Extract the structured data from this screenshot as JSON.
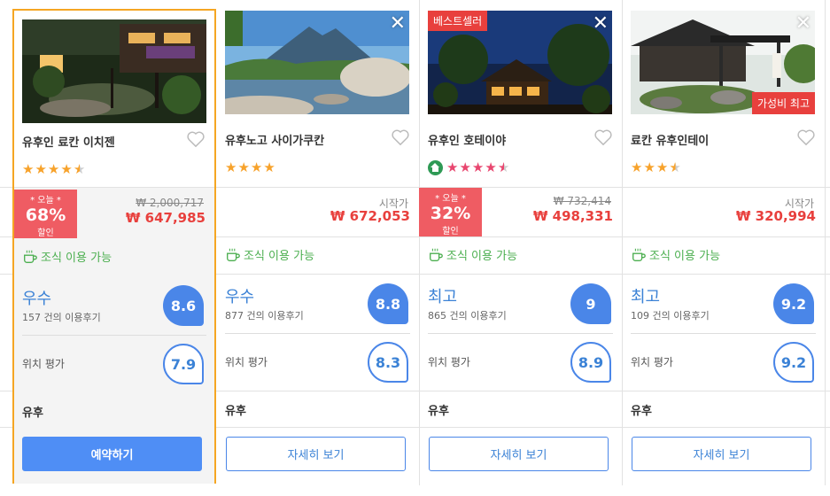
{
  "hotels": [
    {
      "name": "유후인 료칸 이치젠",
      "stars": {
        "full": 4,
        "half": true,
        "style": "orange"
      },
      "discount": {
        "today": "* 오늘 *",
        "percent": "68%",
        "label": "할인"
      },
      "original_price": "₩ 2,000,717",
      "price": "₩ 647,985",
      "breakfast": "조식 이용 가능",
      "rating_word": "우수",
      "reviews": "157 건의 이용후기",
      "score": "8.6",
      "location_label": "위치 평가",
      "location_score": "7.9",
      "area": "유후",
      "button": "예약하기",
      "selected": true
    },
    {
      "name": "유후노고 사이가쿠칸",
      "stars": {
        "full": 4,
        "half": false,
        "style": "orange"
      },
      "from_label": "시작가",
      "price": "₩ 672,053",
      "breakfast": "조식 이용 가능",
      "rating_word": "우수",
      "reviews": "877 건의 이용후기",
      "score": "8.8",
      "location_label": "위치 평가",
      "location_score": "8.3",
      "area": "유후",
      "button": "자세히 보기",
      "selected": false
    },
    {
      "name": "유후인 호테이야",
      "badge": "베스트셀러",
      "stars": {
        "full": 4,
        "half": true,
        "style": "pink"
      },
      "discount": {
        "today": "* 오늘 *",
        "percent": "32%",
        "label": "할인"
      },
      "original_price": "₩ 732,414",
      "price": "₩ 498,331",
      "breakfast": "조식 이용 가능",
      "rating_word": "최고",
      "reviews": "865 건의 이용후기",
      "score": "9",
      "location_label": "위치 평가",
      "location_score": "8.9",
      "area": "유후",
      "button": "자세히 보기",
      "selected": false
    },
    {
      "name": "료칸 유후인테이",
      "badge_value": "가성비 최고",
      "stars": {
        "full": 3,
        "half": true,
        "style": "orange"
      },
      "from_label": "시작가",
      "price": "₩ 320,994",
      "breakfast": "조식 이용 가능",
      "rating_word": "최고",
      "reviews": "109 건의 이용후기",
      "score": "9.2",
      "location_label": "위치 평가",
      "location_score": "9.2",
      "area": "유후",
      "button": "자세히 보기",
      "selected": false
    }
  ],
  "colors": {
    "accent_blue": "#4a86e8",
    "price_red": "#e8403d",
    "discount_bg": "#ef5c63",
    "selected_border": "#f5a623",
    "breakfast_green": "#4caf50"
  },
  "icons": {
    "close": "close-icon",
    "heart": "heart-outline-icon",
    "cup": "coffee-cup-icon",
    "house": "house-badge-icon"
  }
}
